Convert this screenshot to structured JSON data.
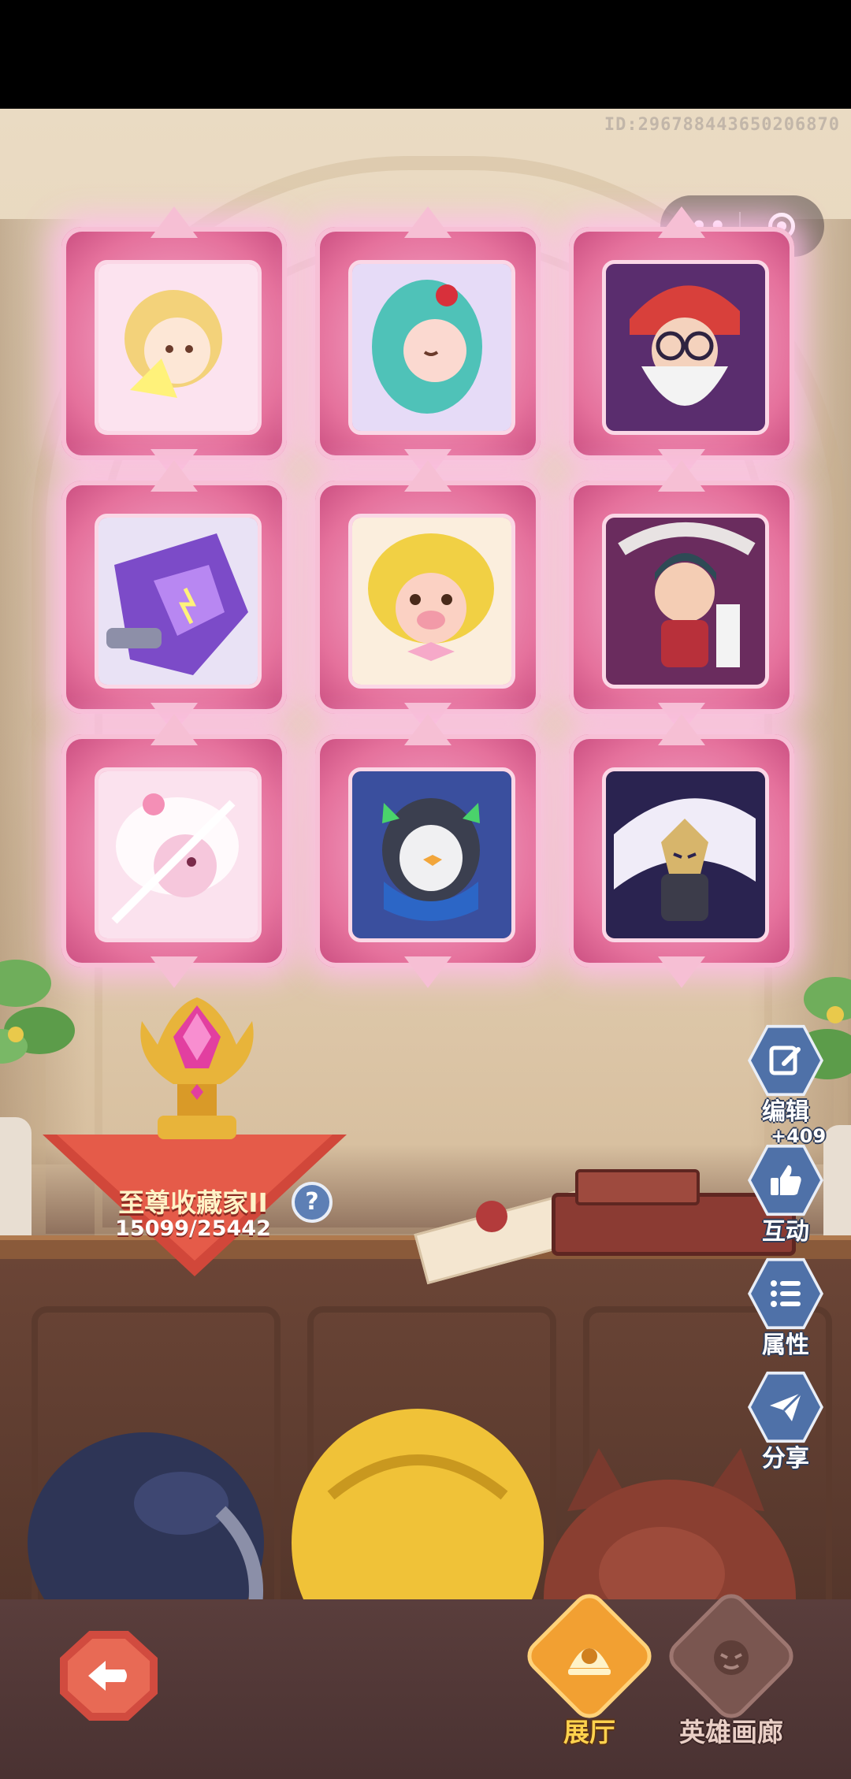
{
  "top": {
    "id_text": "ID:2967884436502068​70"
  },
  "mini_capsule": {
    "more_label": "•••",
    "close_icon": "target-circle-icon"
  },
  "gallery": {
    "cards": [
      {
        "name": "hero-portrait-1",
        "accent": "#f3d27a"
      },
      {
        "name": "hero-portrait-2",
        "accent": "#4fc2b8"
      },
      {
        "name": "hero-portrait-3",
        "accent": "#d8403b"
      },
      {
        "name": "hero-portrait-4",
        "accent": "#7c4bc8"
      },
      {
        "name": "hero-portrait-5",
        "accent": "#f1d044"
      },
      {
        "name": "hero-portrait-6",
        "accent": "#b8303a"
      },
      {
        "name": "hero-portrait-7",
        "accent": "#f6c7dc"
      },
      {
        "name": "hero-portrait-8",
        "accent": "#3c6bc3"
      },
      {
        "name": "hero-portrait-9",
        "accent": "#5a3f8c"
      }
    ]
  },
  "collector": {
    "title": "至尊收藏家II",
    "progress_text": "15099/25442",
    "progress_value": 15099,
    "progress_max": 25442,
    "help_label": "?"
  },
  "side_actions": {
    "edit": {
      "label": "编辑",
      "icon": "edit-icon"
    },
    "interact": {
      "label": "互动",
      "icon": "thumbs-up-icon",
      "count": "+409"
    },
    "attributes": {
      "label": "属性",
      "icon": "list-icon"
    },
    "share": {
      "label": "分享",
      "icon": "paper-plane-icon"
    }
  },
  "bottom_nav": {
    "back_icon": "back-arrow-icon",
    "tabs": [
      {
        "label": "展厅",
        "active": true
      },
      {
        "label": "英雄画廊",
        "active": false
      }
    ]
  },
  "colors": {
    "frame_pink": "#e5719c",
    "button_blue": "#4f71a8",
    "active_orange": "#f2a032",
    "back_red": "#d14b3f"
  }
}
